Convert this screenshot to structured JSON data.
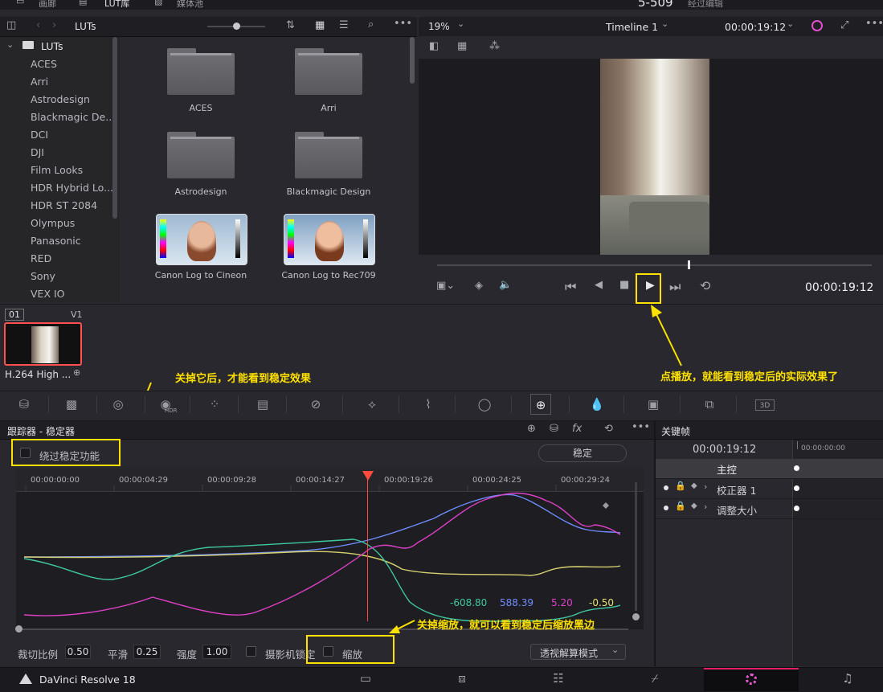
{
  "top_tabs": {
    "gallery": "画廊",
    "lut_library": "LUT库",
    "media_pool": "媒体池",
    "project_name": "5-509",
    "edited_status": "经过编辑"
  },
  "lut_browser": {
    "path_label": "LUTs",
    "tree_root": "LUTs",
    "tree_items": [
      "ACES",
      "Arri",
      "Astrodesign",
      "Blackmagic De...",
      "DCI",
      "DJI",
      "Film Looks",
      "HDR Hybrid Lo...",
      "HDR ST 2084",
      "Olympus",
      "Panasonic",
      "RED",
      "Sony",
      "VEX IO"
    ],
    "thumbs": [
      {
        "label": "ACES",
        "kind": "folder"
      },
      {
        "label": "Arri",
        "kind": "folder"
      },
      {
        "label": "Astrodesign",
        "kind": "folder"
      },
      {
        "label": "Blackmagic Design",
        "kind": "folder"
      },
      {
        "label": "Canon Log to Cineon",
        "kind": "image"
      },
      {
        "label": "Canon Log to Rec709",
        "kind": "image"
      }
    ]
  },
  "viewer": {
    "zoom": "19%",
    "timeline_name": "Timeline 1",
    "timecode_top": "00:00:19:12",
    "timecode_transport": "00:00:19:12"
  },
  "clip": {
    "index": "01",
    "track": "V1",
    "name": "H.264 High ..."
  },
  "annotations": {
    "play": "点播放，就能看到稳定后的实际效果了",
    "bypass": "关掉它后，才能看到稳定效果",
    "zoom": "关掉缩放，就可以看到稳定后缩放黑边"
  },
  "tracker": {
    "title": "跟踪器 - 稳定器",
    "bypass_label": "绕过稳定功能",
    "stabilize_button": "稳定",
    "ruler": [
      "00:00:00:00",
      "00:00:04:29",
      "00:00:09:28",
      "00:00:14:27",
      "00:00:19:26",
      "00:00:24:25",
      "00:00:29:24"
    ],
    "readouts": [
      {
        "value": "-608.80",
        "color": "#3ec8a0"
      },
      {
        "value": "588.39",
        "color": "#6f8cff"
      },
      {
        "value": "5.20",
        "color": "#e040c8"
      },
      {
        "value": "-0.50",
        "color": "#e6e070"
      }
    ],
    "crop_ratio_label": "裁切比例",
    "crop_ratio_value": "0.50",
    "smooth_label": "平滑",
    "smooth_value": "0.25",
    "strength_label": "强度",
    "strength_value": "1.00",
    "camera_lock_label": "摄影机锁定",
    "zoom_label": "缩放",
    "mode_label": "透视解算模式"
  },
  "keyframes": {
    "title": "关键帧",
    "timecode": "00:00:19:12",
    "ruler_start": "00:00:00:00",
    "rows": [
      "主控",
      "校正器 1",
      "调整大小"
    ]
  },
  "app": {
    "name": "DaVinci Resolve 18"
  },
  "colors": {
    "accent": "#ffe100",
    "playhead": "#ff4a3d",
    "clip_border": "#ff5050"
  }
}
